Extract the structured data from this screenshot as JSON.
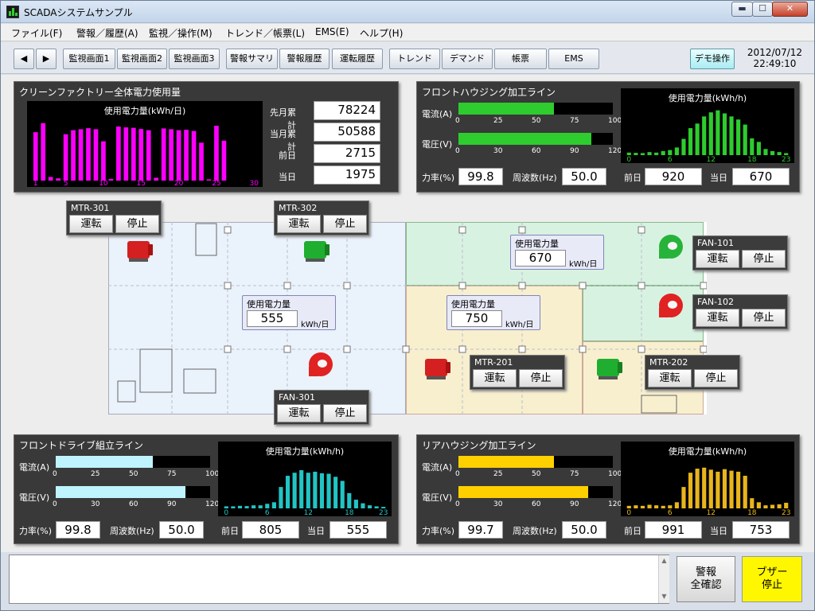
{
  "window": {
    "title": "SCADAシステムサンプル",
    "min": "▬",
    "max": "☐",
    "close": "✕"
  },
  "menu": [
    "ファイル(F)",
    "警報／履歴(A)",
    "監視／操作(M)",
    "トレンド／帳票(L)",
    "EMS(E)",
    "ヘルプ(H)"
  ],
  "toolbar": {
    "back": "◀",
    "forward": "▶",
    "buttons": [
      "監視画面1",
      "監視画面2",
      "監視画面3",
      "警報サマリ",
      "警報履歴",
      "運転履歴",
      "トレンド",
      "デマンド",
      "帳票",
      "EMS"
    ],
    "demo": "デモ操作"
  },
  "clock": {
    "date": "2012/07/12",
    "time": "22:49:10"
  },
  "factory": {
    "title": "クリーンファクトリー全体電力使用量",
    "chart_title": "使用電力量(kWh/日)",
    "stats": [
      {
        "label": "先月累計",
        "value": "78224"
      },
      {
        "label": "当月累計",
        "value": "50588"
      },
      {
        "label": "前日",
        "value": "2715"
      },
      {
        "label": "当日",
        "value": "1975"
      }
    ],
    "ticks": [
      "1",
      "5",
      "10",
      "15",
      "20",
      "25",
      "30"
    ]
  },
  "front_housing": {
    "title": "フロントハウジング加工ライン",
    "current_label": "電流(A)",
    "voltage_label": "電圧(V)",
    "current_fill": 0.62,
    "voltage_fill": 0.86,
    "current_ticks": [
      "0",
      "25",
      "50",
      "75",
      "100"
    ],
    "voltage_ticks": [
      "0",
      "30",
      "60",
      "90",
      "120"
    ],
    "pf_label": "力率(%)",
    "pf": "99.8",
    "freq_label": "周波数(Hz)",
    "freq": "50.0",
    "chart_title": "使用電力量(kWh/h)",
    "chart_ticks": [
      "0",
      "6",
      "12",
      "18",
      "23"
    ],
    "prev_label": "前日",
    "prev": "920",
    "today_label": "当日",
    "today": "670",
    "color": "#2ecc2e"
  },
  "front_drive": {
    "title": "フロントドライブ組立ライン",
    "current_label": "電流(A)",
    "voltage_label": "電圧(V)",
    "current_fill": 0.63,
    "voltage_fill": 0.84,
    "current_ticks": [
      "0",
      "25",
      "50",
      "75",
      "100"
    ],
    "voltage_ticks": [
      "0",
      "30",
      "60",
      "90",
      "120"
    ],
    "pf_label": "力率(%)",
    "pf": "99.8",
    "freq_label": "周波数(Hz)",
    "freq": "50.0",
    "chart_title": "使用電力量(kWh/h)",
    "chart_ticks": [
      "0",
      "6",
      "12",
      "18",
      "23"
    ],
    "prev_label": "前日",
    "prev": "805",
    "today_label": "当日",
    "today": "555",
    "color": "#22c4c4",
    "fill_color": "#bff4ff"
  },
  "rear_housing": {
    "title": "リアハウジング加工ライン",
    "current_label": "電流(A)",
    "voltage_label": "電圧(V)",
    "current_fill": 0.62,
    "voltage_fill": 0.84,
    "current_ticks": [
      "0",
      "25",
      "50",
      "75",
      "100"
    ],
    "voltage_ticks": [
      "0",
      "30",
      "60",
      "90",
      "120"
    ],
    "pf_label": "力率(%)",
    "pf": "99.7",
    "freq_label": "周波数(Hz)",
    "freq": "50.0",
    "chart_title": "使用電力量(kWh/h)",
    "chart_ticks": [
      "0",
      "6",
      "12",
      "18",
      "23"
    ],
    "prev_label": "前日",
    "prev": "991",
    "today_label": "当日",
    "today": "753",
    "color": "#e8b51c",
    "fill_color": "#ffd000"
  },
  "floor": {
    "power_label": "使用電力量",
    "unit": "kWh/日",
    "left_value": "555",
    "green_value": "670",
    "yellow_value": "750"
  },
  "controls": {
    "run": "運転",
    "stop": "停止",
    "units": [
      "MTR-301",
      "MTR-302",
      "FAN-101",
      "FAN-102",
      "MTR-201",
      "MTR-202",
      "FAN-301"
    ]
  },
  "alarm": {
    "ack": "警報\n全確認",
    "buzzer": "ブザー\n停止"
  },
  "chart_data": [
    {
      "type": "bar",
      "title": "使用電力量(kWh/日)",
      "x": [
        1,
        2,
        3,
        4,
        5,
        6,
        7,
        8,
        9,
        10,
        11,
        12,
        13,
        14,
        15,
        16,
        17,
        18,
        19,
        20,
        21,
        22,
        23,
        24,
        25,
        26,
        27,
        28,
        29,
        30
      ],
      "values": [
        2400,
        2850,
        180,
        110,
        2300,
        2500,
        2550,
        2600,
        2550,
        1950,
        80,
        2680,
        2640,
        2620,
        2560,
        2500,
        140,
        2590,
        2550,
        2500,
        2520,
        2460,
        1880,
        60,
        2720,
        1980,
        0,
        0,
        0,
        0
      ],
      "ylim": [
        0,
        3000
      ]
    },
    {
      "type": "bar",
      "title": "使用電力量(kWh/h)",
      "x": [
        0,
        1,
        2,
        3,
        4,
        5,
        6,
        7,
        8,
        9,
        10,
        11,
        12,
        13,
        14,
        15,
        16,
        17,
        18,
        19,
        20,
        21,
        22,
        23
      ],
      "values": [
        50,
        45,
        40,
        60,
        50,
        80,
        100,
        150,
        320,
        530,
        620,
        760,
        840,
        880,
        820,
        760,
        700,
        600,
        330,
        260,
        120,
        80,
        60,
        40
      ],
      "ylim": [
        0,
        1000
      ]
    },
    {
      "type": "bar",
      "title": "使用電力量(kWh/h)",
      "x": [
        0,
        1,
        2,
        3,
        4,
        5,
        6,
        7,
        8,
        9,
        10,
        11,
        12,
        13,
        14,
        15,
        16,
        17,
        18,
        19,
        20,
        21,
        22,
        23
      ],
      "values": [
        40,
        40,
        50,
        45,
        60,
        60,
        90,
        120,
        420,
        640,
        700,
        750,
        700,
        720,
        690,
        680,
        620,
        540,
        300,
        170,
        100,
        60,
        40,
        30
      ],
      "ylim": [
        0,
        1000
      ]
    },
    {
      "type": "bar",
      "title": "使用電力量(kWh/h)",
      "x": [
        0,
        1,
        2,
        3,
        4,
        5,
        6,
        7,
        8,
        9,
        10,
        11,
        12,
        13,
        14,
        15,
        16,
        17,
        18,
        19,
        20,
        21,
        22,
        23
      ],
      "values": [
        50,
        60,
        50,
        70,
        60,
        50,
        60,
        120,
        420,
        700,
        780,
        800,
        760,
        720,
        770,
        740,
        720,
        640,
        200,
        120,
        60,
        70,
        80,
        110
      ],
      "ylim": [
        0,
        1000
      ]
    }
  ]
}
